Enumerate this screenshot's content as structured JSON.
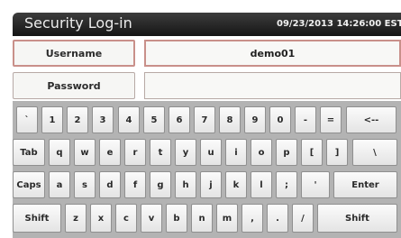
{
  "header": {
    "title": "Security Log-in",
    "datetime": "09/23/2013 14:26:00 EST"
  },
  "form": {
    "username_label": "Username",
    "username_value": "demo01",
    "password_label": "Password",
    "password_value": ""
  },
  "keyboard": {
    "row1": [
      "`",
      "1",
      "2",
      "3",
      "4",
      "5",
      "6",
      "7",
      "8",
      "9",
      "0",
      "-",
      "=",
      "<--"
    ],
    "row2": [
      "Tab",
      "q",
      "w",
      "e",
      "r",
      "t",
      "y",
      "u",
      "i",
      "o",
      "p",
      "[",
      "]",
      "\\"
    ],
    "row3": [
      "Caps",
      "a",
      "s",
      "d",
      "f",
      "g",
      "h",
      "j",
      "k",
      "l",
      ";",
      "'",
      "Enter"
    ],
    "row4": [
      "Shift",
      "z",
      "x",
      "c",
      "v",
      "b",
      "n",
      "m",
      ",",
      ".",
      "/",
      "Shift"
    ]
  },
  "colors": {
    "titlebar": "#1e1e1e",
    "keyboard_bg": "#b3b3b3",
    "field_border": "#b7a9a5"
  }
}
